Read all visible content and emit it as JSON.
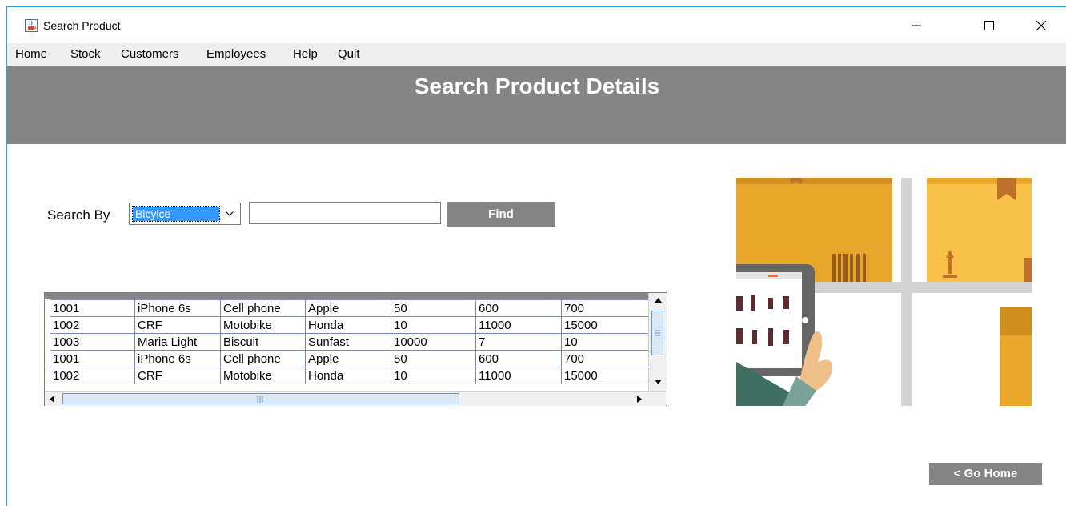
{
  "window": {
    "title": "Search Product",
    "controls": {
      "minimize": "—",
      "maximize": "☐",
      "close": "✕"
    }
  },
  "menu": {
    "items": [
      "Home",
      "Stock",
      "Customers",
      "Employees",
      "Help",
      "Quit"
    ]
  },
  "banner": {
    "title": "Search Product Details"
  },
  "search": {
    "label": "Search By",
    "selected_option": "Bicylce",
    "query_value": "",
    "find_label": "Find"
  },
  "results": {
    "rows": [
      [
        "1001",
        "iPhone 6s",
        "Cell phone",
        "Apple",
        "50",
        "600",
        "700"
      ],
      [
        "1002",
        "CRF",
        "Motobike",
        "Honda",
        "10",
        "11000",
        "15000"
      ],
      [
        "1003",
        "Maria Light",
        "Biscuit",
        "Sunfast",
        "10000",
        "7",
        "10"
      ],
      [
        "1001",
        "iPhone 6s",
        "Cell phone",
        "Apple",
        "50",
        "600",
        "700"
      ],
      [
        "1002",
        "CRF",
        "Motobike",
        "Honda",
        "10",
        "11000",
        "15000"
      ]
    ]
  },
  "navigation": {
    "go_home_label": "< Go Home"
  },
  "colors": {
    "banner_gray": "#858585",
    "box_orange": "#e8a72a",
    "box_light_orange": "#f8c24a",
    "tablet_dark": "#666666",
    "accent_blue": "#2fa0d8"
  },
  "icons": {
    "app": "java-coffee-cup-icon",
    "combo_arrow": "chevron-down-icon",
    "scroll_up": "triangle-up-icon",
    "scroll_down": "triangle-down-icon",
    "scroll_left": "triangle-left-icon",
    "scroll_right": "triangle-right-icon"
  }
}
